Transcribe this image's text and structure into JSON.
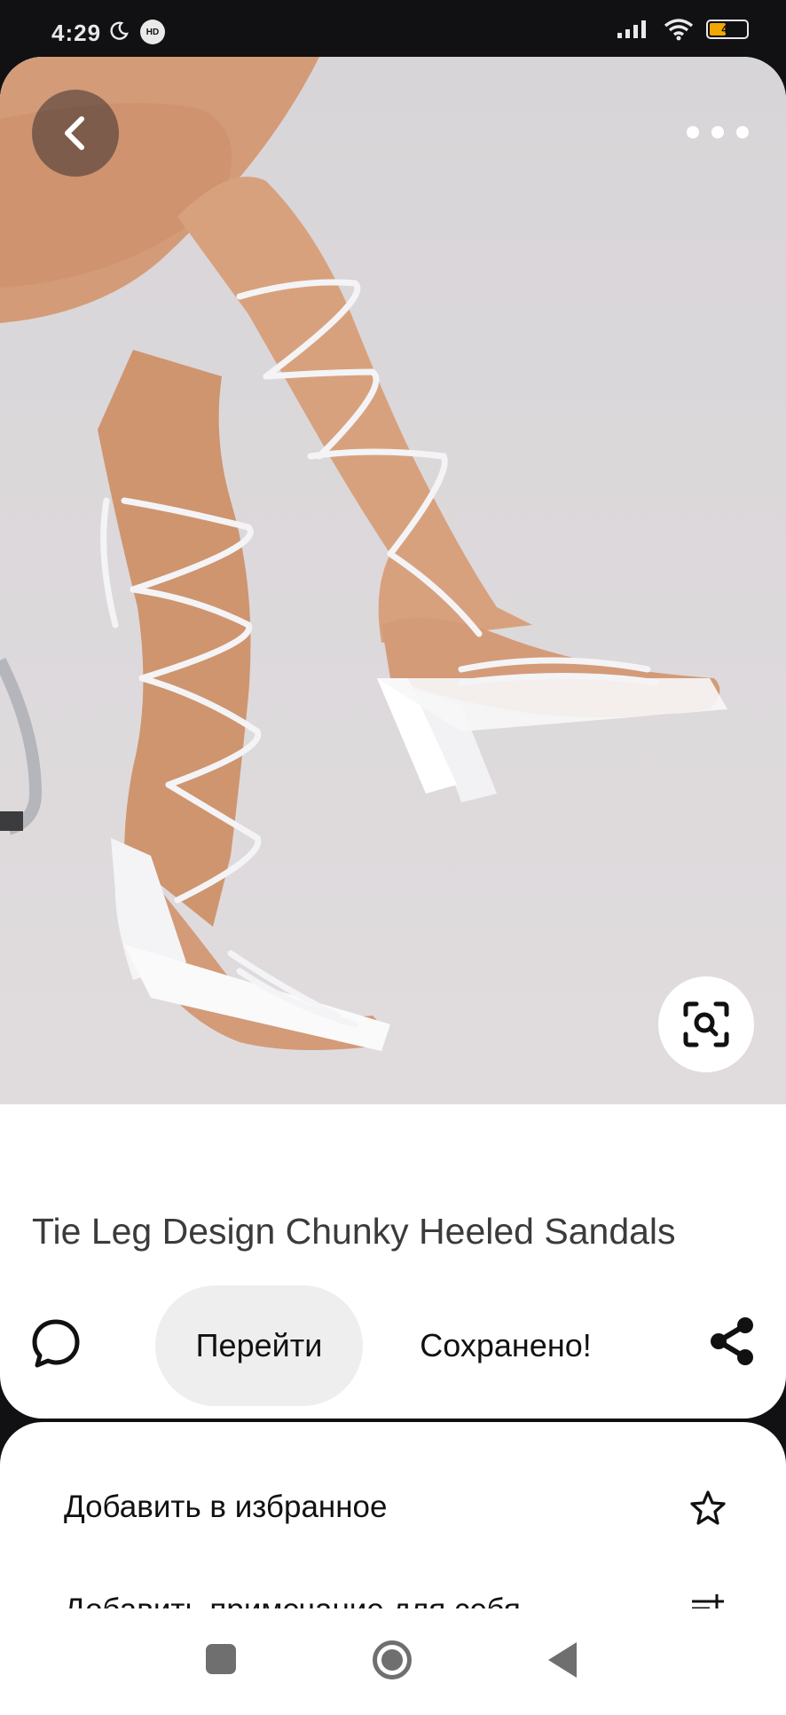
{
  "status_bar": {
    "time": "4:29",
    "badge": "HD",
    "battery": "44"
  },
  "pin": {
    "image_description_icon": "lace-up-sandals-photo",
    "title": "Tie Leg Design Chunky Heeled Sandals"
  },
  "actions": {
    "go_label": "Перейти",
    "saved_label": "Сохранено!"
  },
  "sheet": {
    "items": [
      {
        "label": "Добавить в избранное",
        "icon": "star-icon"
      },
      {
        "label": "Добавить примечание для себя",
        "icon": "add-note-icon"
      }
    ]
  },
  "navbar": {
    "icons": [
      "recents-icon",
      "home-icon",
      "back-icon"
    ]
  },
  "colors": {
    "background": "#111013",
    "card": "#ffffff",
    "go_button_bg": "#efeeee",
    "battery_fill": "#f0a800"
  }
}
